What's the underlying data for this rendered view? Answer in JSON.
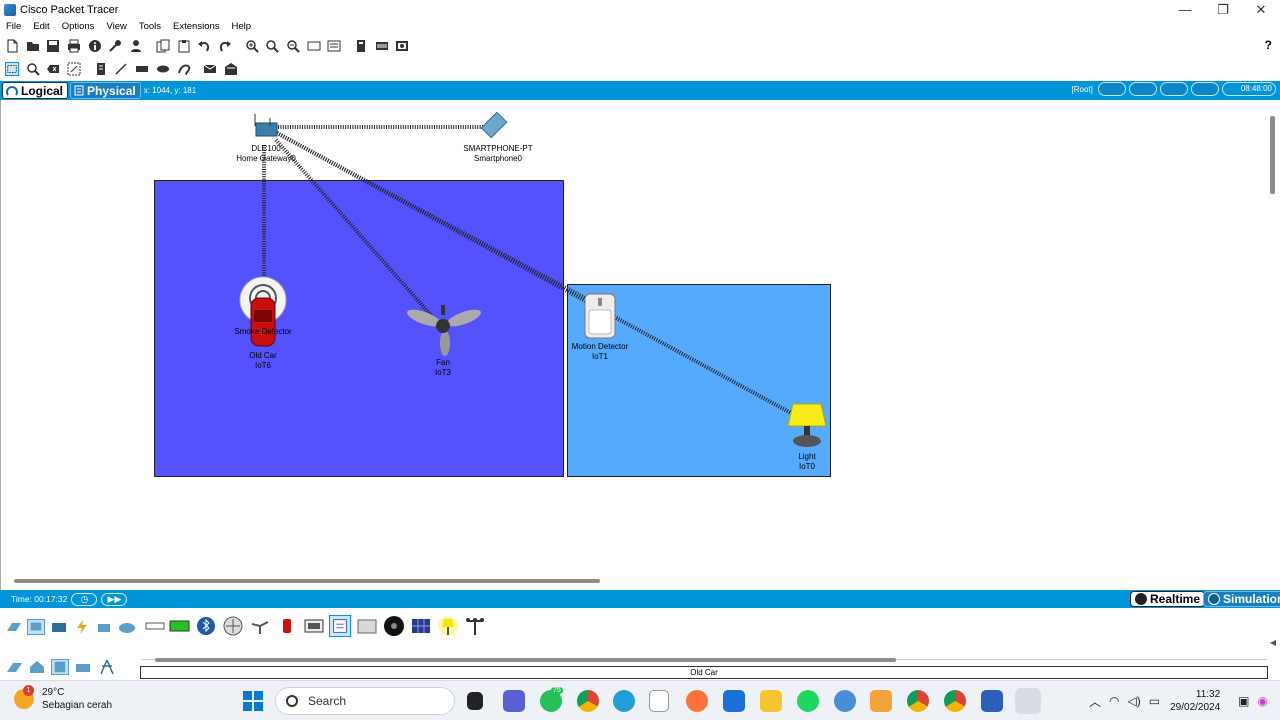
{
  "window": {
    "title": "Cisco Packet Tracer",
    "controls": [
      "—",
      "❐",
      "✕"
    ]
  },
  "menu": [
    "File",
    "Edit",
    "Options",
    "View",
    "Tools",
    "Extensions",
    "Help"
  ],
  "toolbar": {
    "help_label": "?"
  },
  "modebar": {
    "logical_label": "Logical",
    "physical_label": "Physical",
    "coords": "x: 1044, y: 181",
    "root_label": "[Root]",
    "clock": "08:48:00"
  },
  "workspace": {
    "devices": [
      {
        "name": "DLC100",
        "label": "Home Gateway0"
      },
      {
        "name": "SMARTPHONE-PT",
        "label": "Smartphone0"
      },
      {
        "name": "Smoke Detector",
        "label": ""
      },
      {
        "name": "Old Car",
        "label": "IoT6"
      },
      {
        "name": "Fan",
        "label": "IoT3"
      },
      {
        "name": "Motion Detector",
        "label": "IoT1"
      },
      {
        "name": "Light",
        "label": "IoT0"
      }
    ],
    "rooms": [
      {
        "color": "#5451ff"
      },
      {
        "color": "#55aaff"
      }
    ]
  },
  "timebar": {
    "time_label": "Time: 00:17:32",
    "realtime_label": "Realtime",
    "simulation_label": "Simulation"
  },
  "device_panel": {
    "selected_caption": "Old Car"
  },
  "taskbar": {
    "weather_temp": "29°C",
    "weather_desc": "Sebagian cerah",
    "weather_badge": "1",
    "search_placeholder": "Search",
    "whatsapp_badge": "75",
    "time": "11:32",
    "date": "29/02/2024"
  },
  "colors": {
    "accent": "#0094d9",
    "room_dark": "#5451ff",
    "room_light": "#55aaff"
  }
}
